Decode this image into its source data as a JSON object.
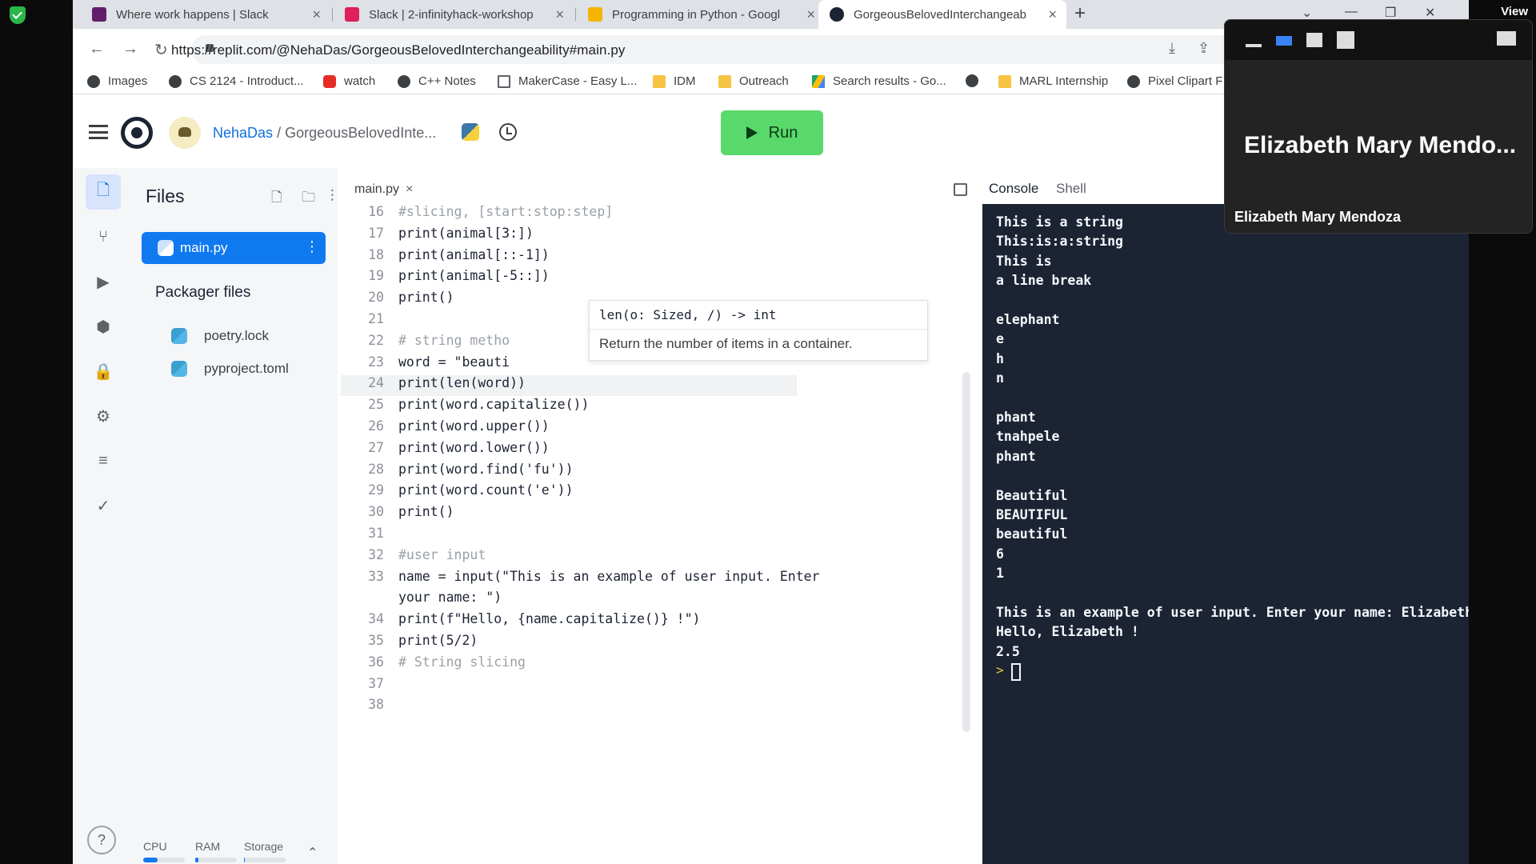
{
  "browser": {
    "tabs": [
      {
        "title": "Where work happens | Slack",
        "color": "#611f69"
      },
      {
        "title": "Slack | 2-infinityhack-workshop",
        "color": "#e01e5a"
      },
      {
        "title": "Programming in Python - Googl",
        "color": "#f4b400"
      },
      {
        "title": "GorgeousBelovedInterchangeab",
        "color": "#1c2333"
      }
    ],
    "new_tab": "+",
    "url": "https://replit.com/@NehaDas/GorgeousBelovedInterchangeability#main.py",
    "bookmarks": [
      {
        "label": "Images",
        "icon": "globe"
      },
      {
        "label": "CS 2124 - Introduct...",
        "icon": "globe"
      },
      {
        "label": "watch",
        "icon": "yt"
      },
      {
        "label": "C++ Notes",
        "icon": "globe"
      },
      {
        "label": "MakerCase - Easy L...",
        "icon": "doc"
      },
      {
        "label": "IDM",
        "icon": "folder"
      },
      {
        "label": "Outreach",
        "icon": "folder"
      },
      {
        "label": "Search results - Go...",
        "icon": "drive"
      },
      {
        "label": "",
        "icon": "globe"
      },
      {
        "label": "MARL Internship",
        "icon": "folder"
      },
      {
        "label": "Pixel Clipart F",
        "icon": "globe"
      }
    ],
    "view_label": "View"
  },
  "replit": {
    "user": "NehaDas",
    "separator": "/",
    "repl_name": "GorgeousBelovedInte...",
    "run_label": "Run"
  },
  "files": {
    "title": "Files",
    "main_file": "main.py",
    "packager_title": "Packager files",
    "packager_files": [
      "poetry.lock",
      "pyproject.toml"
    ],
    "resources": {
      "cpu_label": "CPU",
      "ram_label": "RAM",
      "storage_label": "Storage",
      "cpu": 0.35,
      "ram": 0.08,
      "storage": 0.02
    }
  },
  "editor": {
    "tab": "main.py",
    "lines": [
      {
        "n": "16",
        "t": "#slicing, [start:stop:step]",
        "cm": true
      },
      {
        "n": "17",
        "t": "print(animal[3:])"
      },
      {
        "n": "18",
        "t": "print(animal[::-1])"
      },
      {
        "n": "19",
        "t": "print(animal[-5::])"
      },
      {
        "n": "20",
        "t": "print()"
      },
      {
        "n": "21",
        "t": ""
      },
      {
        "n": "22",
        "t": "# string metho",
        "cm": true
      },
      {
        "n": "23",
        "t": "word = \"beauti"
      },
      {
        "n": "24",
        "t": "print(len(word))",
        "cur": true
      },
      {
        "n": "25",
        "t": "print(word.capitalize())"
      },
      {
        "n": "26",
        "t": "print(word.upper())"
      },
      {
        "n": "27",
        "t": "print(word.lower())"
      },
      {
        "n": "28",
        "t": "print(word.find('fu'))"
      },
      {
        "n": "29",
        "t": "print(word.count('e'))"
      },
      {
        "n": "30",
        "t": "print()"
      },
      {
        "n": "31",
        "t": ""
      },
      {
        "n": "32",
        "t": "#user input",
        "cm": true
      },
      {
        "n": "33",
        "t": "name = input(\"This is an example of user input. Enter"
      },
      {
        "n": "",
        "t": "your name: \")"
      },
      {
        "n": "34",
        "t": "print(f\"Hello, {name.capitalize()} !\")"
      },
      {
        "n": "35",
        "t": "print(5/2)"
      },
      {
        "n": "36",
        "t": "# String slicing",
        "cm": true
      },
      {
        "n": "37",
        "t": ""
      },
      {
        "n": "38",
        "t": ""
      }
    ],
    "tooltip": {
      "signature": "len(o: Sized, /) -> int",
      "doc": "Return the number of items in a container."
    }
  },
  "console": {
    "tabs": [
      "Console",
      "Shell"
    ],
    "lines": [
      "This is a string",
      "This:is:a:string",
      "This is",
      "a line break",
      "",
      "elephant",
      "e",
      "h",
      "n",
      "",
      "phant",
      "tnahpele",
      "phant",
      "",
      "Beautiful",
      "BEAUTIFUL",
      "beautiful",
      "6",
      "1",
      "",
      "This is an example of user input. Enter your name: Elizabeth",
      "Hello, Elizabeth !",
      "2.5"
    ],
    "prompt": ">"
  },
  "video": {
    "name_large": "Elizabeth Mary Mendo...",
    "name_small": "Elizabeth Mary Mendoza"
  }
}
